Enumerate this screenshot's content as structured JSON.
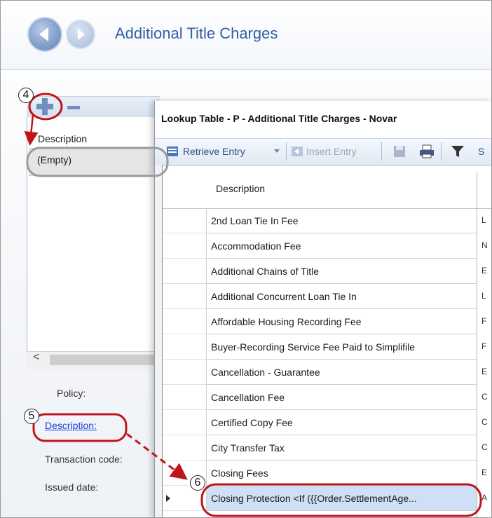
{
  "header": {
    "title": "Additional Title Charges",
    "back_icon": "back-arrow-icon",
    "forward_icon": "forward-arrow-icon"
  },
  "left_panel": {
    "column_header": "Description",
    "empty_row": "(Empty)",
    "scroll_left": "<"
  },
  "form_labels": {
    "policy": "Policy:",
    "description": "Description:",
    "transaction_code": "Transaction code:",
    "issued_date": "Issued date:"
  },
  "lookup": {
    "title": "Lookup Table - P - Additional Title Charges - Novar",
    "toolbar": {
      "retrieve": "Retrieve Entry",
      "insert": "Insert Entry",
      "search_partial": "S"
    },
    "column_header": "Description",
    "rows": [
      {
        "description": "2nd Loan Tie In Fee",
        "next": "L"
      },
      {
        "description": "Accommodation Fee",
        "next": "N"
      },
      {
        "description": "Additional Chains of Title",
        "next": "E"
      },
      {
        "description": "Additional Concurrent Loan Tie In",
        "next": "L"
      },
      {
        "description": "Affordable Housing Recording Fee",
        "next": "F"
      },
      {
        "description": "Buyer-Recording Service Fee Paid to Simplifile",
        "next": "F"
      },
      {
        "description": "Cancellation - Guarantee",
        "next": "E"
      },
      {
        "description": "Cancellation Fee",
        "next": "C"
      },
      {
        "description": "Certified Copy Fee",
        "next": "C"
      },
      {
        "description": "City Transfer Tax",
        "next": "C"
      },
      {
        "description": "Closing Fees",
        "next": "E"
      },
      {
        "description": "Closing Protection <If ({{Order.SettlementAge...",
        "next": "A"
      }
    ]
  },
  "callouts": {
    "four": "4",
    "five": "5",
    "six": "6"
  },
  "colors": {
    "accent": "#335fa5",
    "callout": "#c0151b",
    "link": "#1a3fd8"
  }
}
